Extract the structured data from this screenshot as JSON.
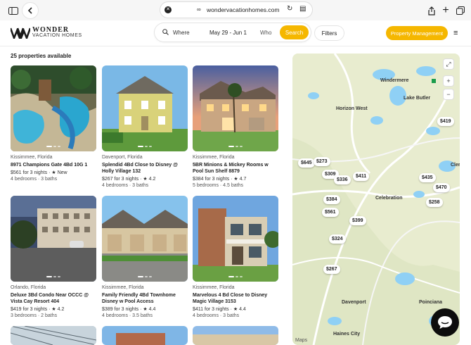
{
  "browser": {
    "url": "wondervacationhomes.com"
  },
  "header": {
    "logo_top": "WONDER",
    "logo_bottom": "VACATION HOMES",
    "search": {
      "where": "Where",
      "dates": "May 29 - Jun 1",
      "who": "Who",
      "search_label": "Search"
    },
    "filters_label": "Filters",
    "property_management_label": "Property Management"
  },
  "results": {
    "count_label": "25 properties available",
    "listings": [
      {
        "location": "Kissimmee, Florida",
        "title": "8971 Champions Gate 4Bd 10G 1",
        "price": "$561 for 3 nights",
        "rating": "★ New",
        "rooms": "4 bedrooms · 3 baths"
      },
      {
        "location": "Davenport, Florida",
        "title": "Splendid 4Bd Close to Disney @ Holly Village 132",
        "price": "$267 for 3 nights",
        "rating": "★ 4.2",
        "rooms": "4 bedrooms · 3 baths"
      },
      {
        "location": "Kissimmee, Florida",
        "title": "5BR Minions & Mickey Rooms w Pool Sun Shelf 8879",
        "price": "$384 for 3 nights",
        "rating": "★ 4.7",
        "rooms": "5 bedrooms · 4.5 baths"
      },
      {
        "location": "Orlando, Florida",
        "title": "Deluxe 3Bd Condo Near OCCC @ Vista Cay Resort 404",
        "price": "$419 for 3 nights",
        "rating": "★ 4.2",
        "rooms": "3 bedrooms · 2 baths"
      },
      {
        "location": "Kissimmee, Florida",
        "title": "Family Friendly 4Bd Townhome Disney w Pool Access",
        "price": "$389 for 3 nights",
        "rating": "★ 4.4",
        "rooms": "4 bedrooms · 3.5 baths"
      },
      {
        "location": "Kissimmee, Florida",
        "title": "Marvelous 4 Bd Close to Disney Magic Village 3153",
        "price": "$411 for 3 nights",
        "rating": "★ 4.4",
        "rooms": "4 bedrooms · 3 baths"
      }
    ]
  },
  "map": {
    "labels": [
      "Windermere",
      "Lake Butler",
      "Horizon West",
      "Celebration",
      "Davenport",
      "Poinciana",
      "Haines City",
      "Clerm"
    ],
    "pins": [
      "$419",
      "$645",
      "$273",
      "$309",
      "$336",
      "$411",
      "$435",
      "$470",
      "$258",
      "$384",
      "$561",
      "$399",
      "$324",
      "$267"
    ],
    "brand": "Maps"
  },
  "colors": {
    "accent": "#f5b700",
    "map_land": "#e8eccf",
    "map_water": "#8fd0f5"
  }
}
